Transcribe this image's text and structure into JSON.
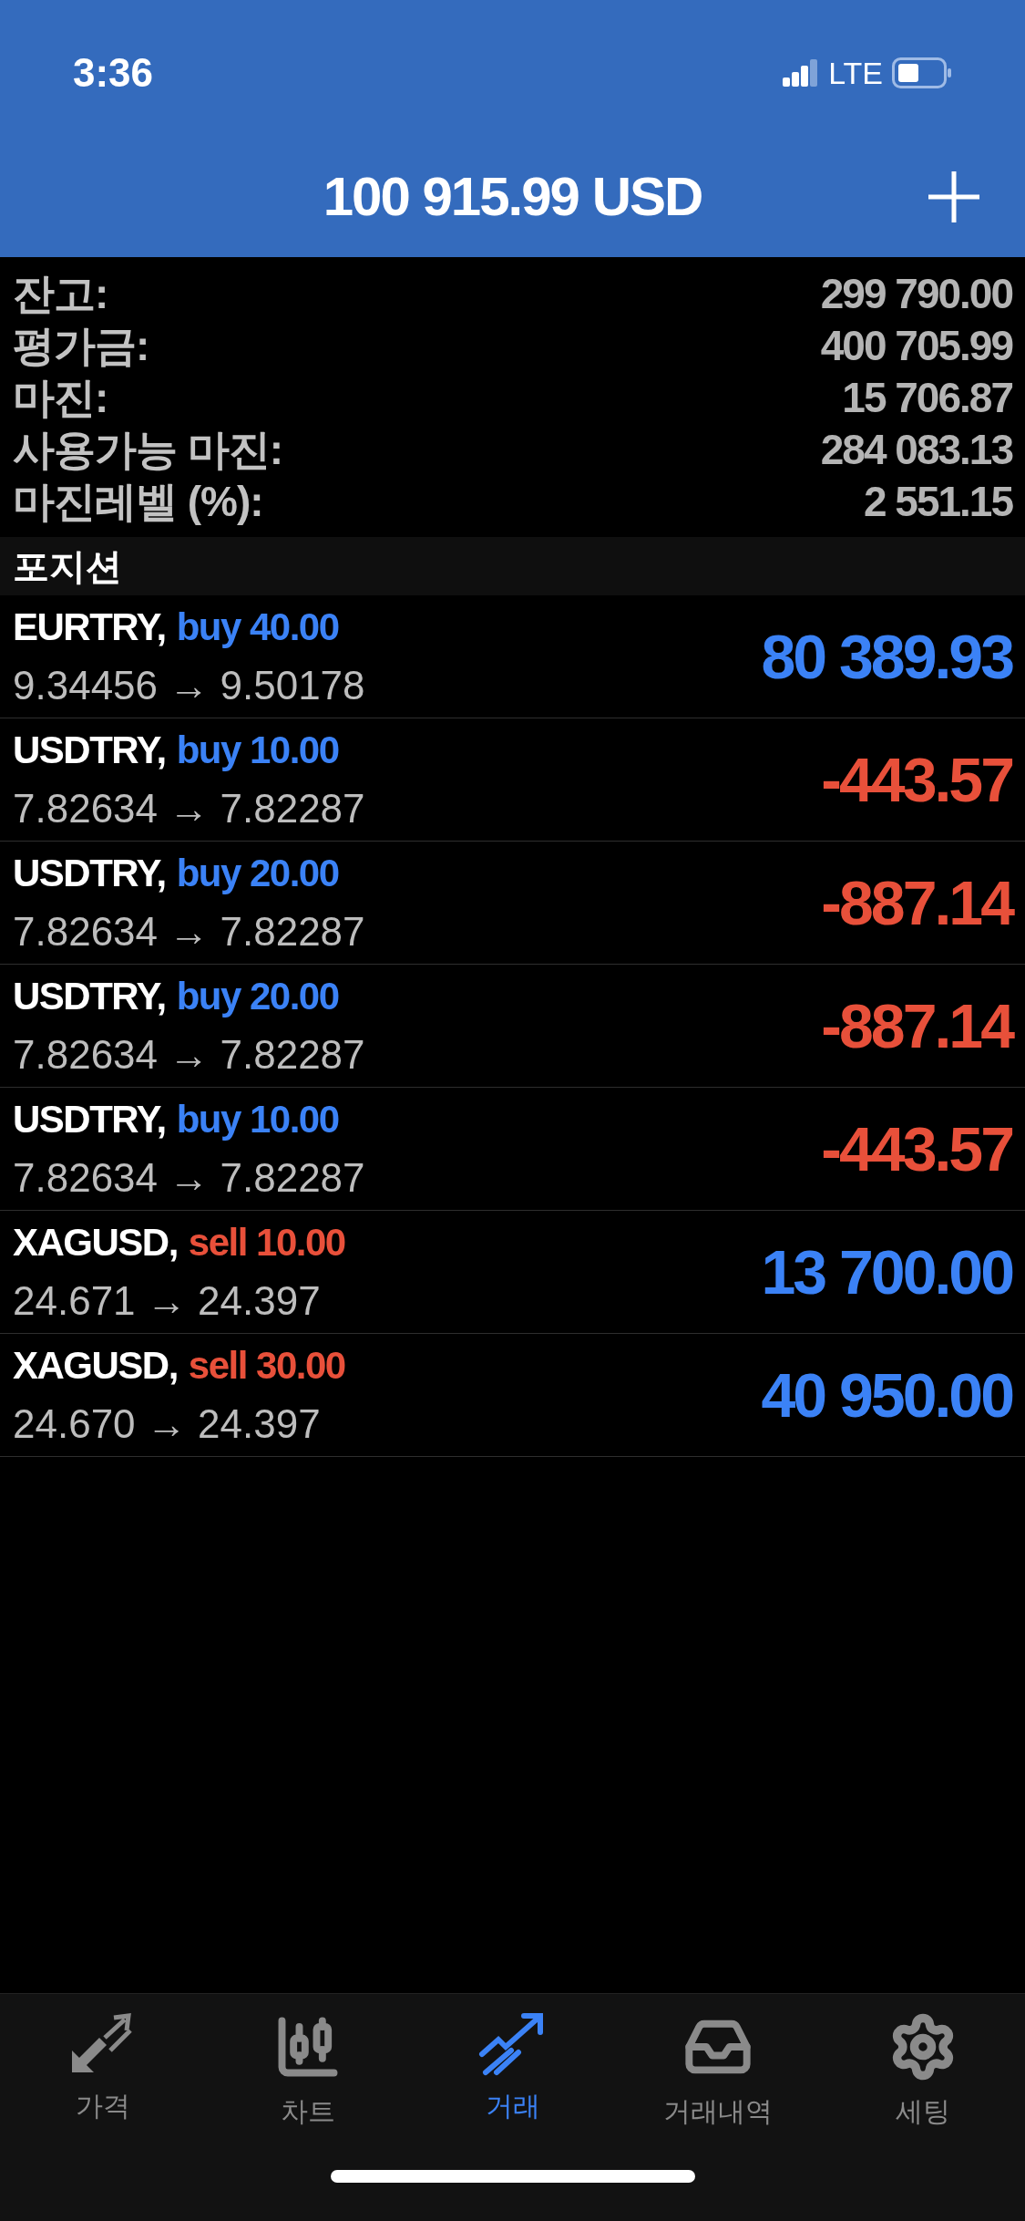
{
  "status_bar": {
    "time": "3:36",
    "network": "LTE"
  },
  "header": {
    "title": "100 915.99 USD"
  },
  "summary": [
    {
      "label": "잔고:",
      "value": "299 790.00"
    },
    {
      "label": "평가금:",
      "value": "400 705.99"
    },
    {
      "label": "마진:",
      "value": "15 706.87"
    },
    {
      "label": "사용가능 마진:",
      "value": "284 083.13"
    },
    {
      "label": "마진레벨 (%):",
      "value": "2 551.15"
    }
  ],
  "section": {
    "title": "포지션"
  },
  "positions": [
    {
      "symbol": "EURTRY,",
      "order": {
        "text": "buy 40.00",
        "color": "#3b82f6"
      },
      "prices": "9.34456 → 9.50178",
      "profit": {
        "text": "80 389.93",
        "color": "#3b82f6"
      }
    },
    {
      "symbol": "USDTRY,",
      "order": {
        "text": "buy 10.00",
        "color": "#3b82f6"
      },
      "prices": "7.82634 → 7.82287",
      "profit": {
        "text": "-443.57",
        "color": "#e8503a"
      }
    },
    {
      "symbol": "USDTRY,",
      "order": {
        "text": "buy 20.00",
        "color": "#3b82f6"
      },
      "prices": "7.82634 → 7.82287",
      "profit": {
        "text": "-887.14",
        "color": "#e8503a"
      }
    },
    {
      "symbol": "USDTRY,",
      "order": {
        "text": "buy 20.00",
        "color": "#3b82f6"
      },
      "prices": "7.82634 → 7.82287",
      "profit": {
        "text": "-887.14",
        "color": "#e8503a"
      }
    },
    {
      "symbol": "USDTRY,",
      "order": {
        "text": "buy 10.00",
        "color": "#3b82f6"
      },
      "prices": "7.82634 → 7.82287",
      "profit": {
        "text": "-443.57",
        "color": "#e8503a"
      }
    },
    {
      "symbol": "XAGUSD,",
      "order": {
        "text": "sell 10.00",
        "color": "#e8503a"
      },
      "prices": "24.671 → 24.397",
      "profit": {
        "text": "13 700.00",
        "color": "#3b82f6"
      }
    },
    {
      "symbol": "XAGUSD,",
      "order": {
        "text": "sell 30.00",
        "color": "#e8503a"
      },
      "prices": "24.670 → 24.397",
      "profit": {
        "text": "40 950.00",
        "color": "#3b82f6"
      }
    }
  ],
  "tabs": [
    {
      "kind": "quotes",
      "label": "가격",
      "selected": false
    },
    {
      "kind": "chart",
      "label": "차트",
      "selected": false
    },
    {
      "kind": "trade",
      "label": "거래",
      "selected": true
    },
    {
      "kind": "history",
      "label": "거래내역",
      "selected": false
    },
    {
      "kind": "settings",
      "label": "세팅",
      "selected": false
    }
  ]
}
